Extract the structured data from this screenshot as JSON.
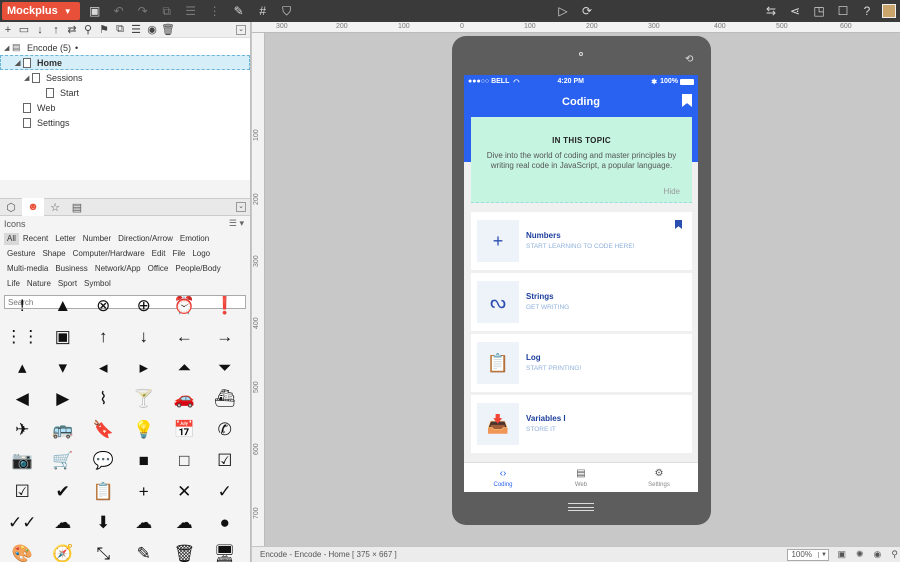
{
  "app": {
    "name": "Mockplus"
  },
  "toolbar": {
    "left_icons": [
      "save-icon",
      "undo-icon",
      "redo-icon",
      "group-icon",
      "align-icon",
      "distribute-icon",
      "brush-icon",
      "grid-icon",
      "bucket-icon"
    ],
    "center_icons": [
      "play-icon",
      "sync-icon"
    ],
    "right_icons": [
      "export-icon",
      "share-icon",
      "preview-icon",
      "layout-icon",
      "help-icon"
    ]
  },
  "tree": {
    "project": "Encode (5)",
    "project_marker": "•",
    "items": [
      {
        "label": "Home",
        "level": 1,
        "selected": true
      },
      {
        "label": "Sessions",
        "level": 1,
        "expandable": true
      },
      {
        "label": "Start",
        "level": 2
      },
      {
        "label": "Web",
        "level": 1
      },
      {
        "label": "Settings",
        "level": 1
      }
    ]
  },
  "library": {
    "title": "Icons",
    "categories": [
      "All",
      "Recent",
      "Letter",
      "Number",
      "Direction/Arrow",
      "Emotion",
      "Gesture",
      "Shape",
      "Computer/Hardware",
      "Edit",
      "File",
      "Logo",
      "Multi-media",
      "Business",
      "Network/App",
      "Office",
      "People/Body",
      "Life",
      "Nature",
      "Sport",
      "Symbol"
    ],
    "active_category": "All",
    "search_placeholder": "Search",
    "icons": [
      {
        "name": "exclamation-icon",
        "glyph": "!"
      },
      {
        "name": "warning-icon",
        "glyph": "▲"
      },
      {
        "name": "cancel-circle-icon",
        "glyph": "⊗"
      },
      {
        "name": "add-circle-icon",
        "glyph": "⊕"
      },
      {
        "name": "alarm-icon",
        "glyph": "⏰"
      },
      {
        "name": "error-icon",
        "glyph": "❗"
      },
      {
        "name": "blank-0",
        "glyph": ""
      },
      {
        "name": "apps-icon",
        "glyph": "⋮⋮"
      },
      {
        "name": "archive-icon",
        "glyph": "▣"
      },
      {
        "name": "arrow-up-icon",
        "glyph": "↑"
      },
      {
        "name": "arrow-down-icon",
        "glyph": "↓"
      },
      {
        "name": "arrow-left-icon",
        "glyph": "←"
      },
      {
        "name": "arrow-right-icon",
        "glyph": "→"
      },
      {
        "name": "blank-1",
        "glyph": ""
      },
      {
        "name": "caret-up-icon",
        "glyph": "▴"
      },
      {
        "name": "caret-down-icon",
        "glyph": "▾"
      },
      {
        "name": "caret-left-icon",
        "glyph": "◂"
      },
      {
        "name": "caret-right-icon",
        "glyph": "▸"
      },
      {
        "name": "circle-up-icon",
        "glyph": "⏶"
      },
      {
        "name": "circle-down-icon",
        "glyph": "⏷"
      },
      {
        "name": "blank-2",
        "glyph": ""
      },
      {
        "name": "circle-left-icon",
        "glyph": "◀"
      },
      {
        "name": "circle-right-icon",
        "glyph": "▶"
      },
      {
        "name": "attach-icon",
        "glyph": "⌇"
      },
      {
        "name": "cocktail-icon",
        "glyph": "🍸"
      },
      {
        "name": "car-icon",
        "glyph": "🚗"
      },
      {
        "name": "boat-icon",
        "glyph": "⛴"
      },
      {
        "name": "blank-3",
        "glyph": ""
      },
      {
        "name": "plane-icon",
        "glyph": "✈"
      },
      {
        "name": "bus-icon",
        "glyph": "🚌"
      },
      {
        "name": "bookmark-icon",
        "glyph": "🔖"
      },
      {
        "name": "bulb-icon",
        "glyph": "💡"
      },
      {
        "name": "calendar-icon",
        "glyph": "📅"
      },
      {
        "name": "phone-icon",
        "glyph": "✆"
      },
      {
        "name": "blank-4",
        "glyph": ""
      },
      {
        "name": "camera-icon",
        "glyph": "📷"
      },
      {
        "name": "cart-icon",
        "glyph": "🛒"
      },
      {
        "name": "chat-icon",
        "glyph": "💬"
      },
      {
        "name": "square-filled-icon",
        "glyph": "■"
      },
      {
        "name": "square-outline-icon",
        "glyph": "□"
      },
      {
        "name": "checkbox-checked-icon",
        "glyph": "☑"
      },
      {
        "name": "blank-5",
        "glyph": ""
      },
      {
        "name": "checkbox-icon",
        "glyph": "☑"
      },
      {
        "name": "check-circle-icon",
        "glyph": "✔"
      },
      {
        "name": "clipboard-icon",
        "glyph": "📋"
      },
      {
        "name": "plus-icon",
        "glyph": "+"
      },
      {
        "name": "close-icon",
        "glyph": "✕"
      },
      {
        "name": "check-icon",
        "glyph": "✓"
      },
      {
        "name": "blank-6",
        "glyph": ""
      },
      {
        "name": "double-check-icon",
        "glyph": "✓✓"
      },
      {
        "name": "cloud-icon",
        "glyph": "☁"
      },
      {
        "name": "cloud-download-icon",
        "glyph": "⬇"
      },
      {
        "name": "cloud-done-icon",
        "glyph": "☁"
      },
      {
        "name": "cloud-outline-icon",
        "glyph": "☁"
      },
      {
        "name": "cloud-circle-icon",
        "glyph": "●"
      },
      {
        "name": "blank-7",
        "glyph": ""
      },
      {
        "name": "palette-icon",
        "glyph": "🎨"
      },
      {
        "name": "compass-icon",
        "glyph": "🧭"
      },
      {
        "name": "compress-icon",
        "glyph": "⤡"
      },
      {
        "name": "pencil-icon",
        "glyph": "✎"
      },
      {
        "name": "trash-icon",
        "glyph": "🗑"
      },
      {
        "name": "monitor-icon",
        "glyph": "🖥"
      },
      {
        "name": "blank-8",
        "glyph": ""
      }
    ]
  },
  "rulers": {
    "top": [
      "300",
      "200",
      "100",
      "0",
      "100",
      "200",
      "300",
      "400",
      "500",
      "600"
    ],
    "left": [
      "100",
      "200",
      "300",
      "400",
      "500",
      "600",
      "700"
    ]
  },
  "status_bar": {
    "path": "Encode - Encode - Home [ 375 × 667 ]",
    "zoom": "100%"
  },
  "device": {
    "status": {
      "carrier": "●●●○○ BELL",
      "wifi": "wifi",
      "time": "4:20 PM",
      "bluetooth": "✱",
      "battery": "100%"
    },
    "nav_title": "Coding",
    "topic": {
      "heading": "IN THIS TOPIC",
      "body": "Dive into the world of coding and master principles by writing real code in JavaScript, a popular language.",
      "hide_label": "Hide"
    },
    "cards": [
      {
        "title": "Numbers",
        "subtitle": "START LEARNING TO CODE HERE!",
        "icon": "plus-icon",
        "glyph": "+",
        "bookmarked": true
      },
      {
        "title": "Strings",
        "subtitle": "GET WRITING",
        "icon": "string-icon",
        "glyph": "ᔓ",
        "bookmarked": false
      },
      {
        "title": "Log",
        "subtitle": "START PRINTING!",
        "icon": "clipboard-icon",
        "glyph": "📋",
        "bookmarked": false
      },
      {
        "title": "Variables I",
        "subtitle": "STORE IT",
        "icon": "inbox-icon",
        "glyph": "📥",
        "bookmarked": false
      }
    ],
    "tabs": [
      {
        "label": "Coding",
        "icon": "code-icon",
        "glyph": "‹›",
        "active": true
      },
      {
        "label": "Web",
        "icon": "browser-icon",
        "glyph": "▤",
        "active": false
      },
      {
        "label": "Settings",
        "icon": "gear-icon",
        "glyph": "⚙",
        "active": false
      }
    ]
  },
  "colors": {
    "brand": "#e8503a",
    "primary": "#2962f1",
    "topic_bg": "#c5f5e1"
  }
}
